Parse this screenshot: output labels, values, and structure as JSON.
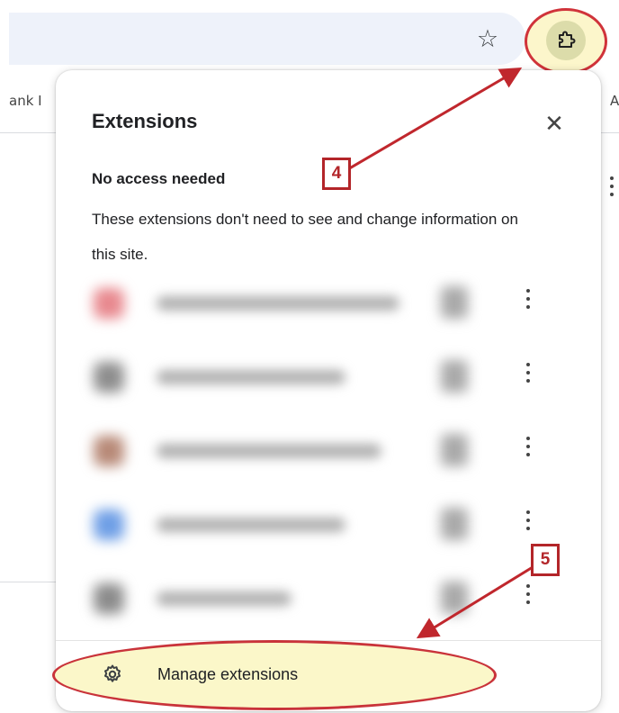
{
  "bookmarks": {
    "partial_left": "ank I",
    "partial_right": "A"
  },
  "popup": {
    "title": "Extensions",
    "close_label": "✕",
    "section_heading": "No access needed",
    "section_description": "These extensions don't need to see and change information on this site.",
    "extensions": [
      {
        "icon_color": "#e8898f",
        "name_width": 270
      },
      {
        "icon_color": "#8e8e8e",
        "name_width": 210
      },
      {
        "icon_color": "#b88a78",
        "name_width": 250
      },
      {
        "icon_color": "#6f9fe6",
        "name_width": 210
      },
      {
        "icon_color": "#8c8c8c",
        "name_width": 150
      }
    ],
    "manage_label": "Manage extensions"
  },
  "annotations": {
    "step_4": "4",
    "step_5": "5"
  },
  "colors": {
    "annotation_red": "#b32529",
    "highlight_yellow": "#fbf7c9"
  }
}
